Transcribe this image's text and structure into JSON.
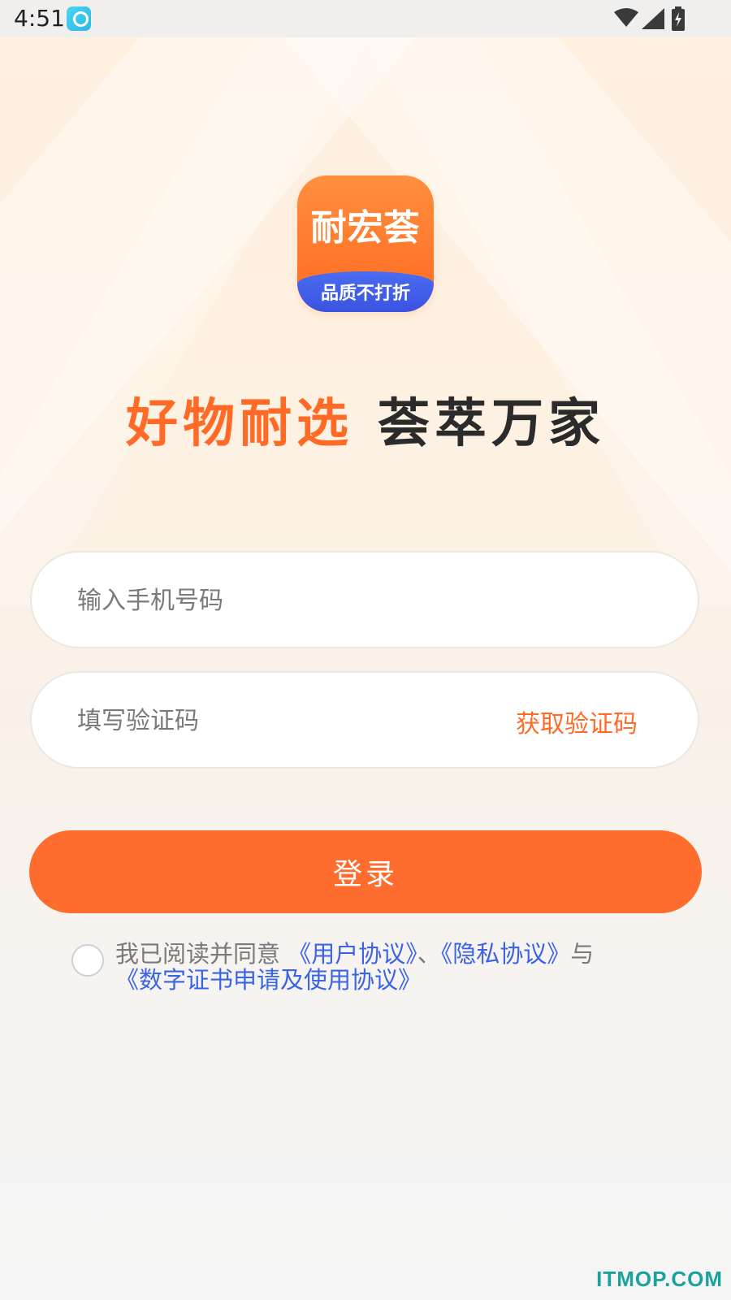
{
  "status_bar": {
    "time": "4:51"
  },
  "logo": {
    "title": "耐宏荟",
    "tagline": "品质不打折"
  },
  "slogan": {
    "part1": "好物耐选",
    "part2": "荟萃万家"
  },
  "phone_input": {
    "placeholder": "输入手机号码"
  },
  "code_input": {
    "placeholder": "填写验证码",
    "get_code_label": "获取验证码"
  },
  "login_button": {
    "label": "登录"
  },
  "agreement": {
    "prefix": "我已阅读并同意",
    "user_agreement": "《用户协议》",
    "separator": "、",
    "privacy_agreement": "《隐私协议》",
    "conjunction": "与",
    "cert_agreement": "《数字证书申请及使用协议》"
  },
  "watermark": "ITMOP.COM",
  "colors": {
    "accent": "#ff6d2e",
    "link": "#3b63e8",
    "logo_blue": "#3a53e0"
  }
}
